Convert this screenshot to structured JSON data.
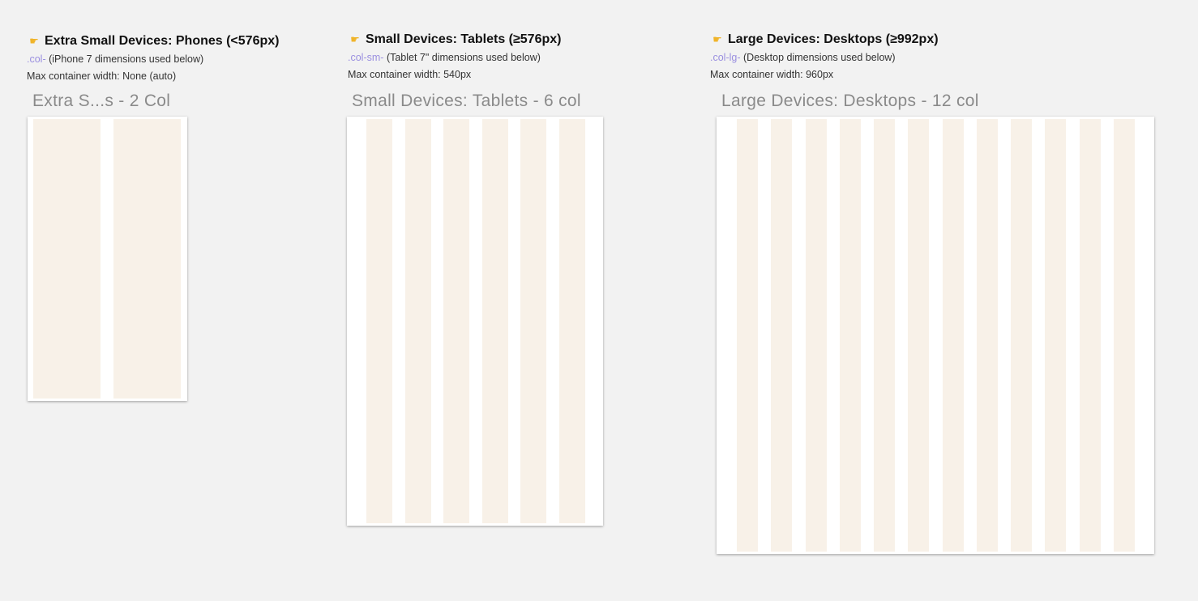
{
  "sections": [
    {
      "title": "Extra Small Devices: Phones (<576px)",
      "class_name": ".col-",
      "note": "(iPhone 7 dimensions used below)",
      "max_width": "Max container width: None (auto)",
      "frame_label": "Extra S...s - 2 Col",
      "columns": 2
    },
    {
      "title": "Small Devices: Tablets (≥576px)",
      "class_name": ".col-sm-",
      "note": "(Tablet 7\" dimensions used below)",
      "max_width": "Max container width: 540px",
      "frame_label": "Small Devices: Tablets - 6 col",
      "columns": 6
    },
    {
      "title": "Large Devices: Desktops (≥992px)",
      "class_name": ".col-lg-",
      "note": "(Desktop dimensions used below)",
      "max_width": "Max container width: 960px",
      "frame_label": "Large Devices: Desktops - 12 col",
      "columns": 12
    }
  ],
  "colors": {
    "background": "#f2f2f2",
    "column": "#f8f1e8",
    "frame": "#ffffff",
    "class_name": "#9a8fe0",
    "pointer_icon": "#f0b429"
  },
  "icons": {
    "pointer": "pointing-hand-icon"
  }
}
